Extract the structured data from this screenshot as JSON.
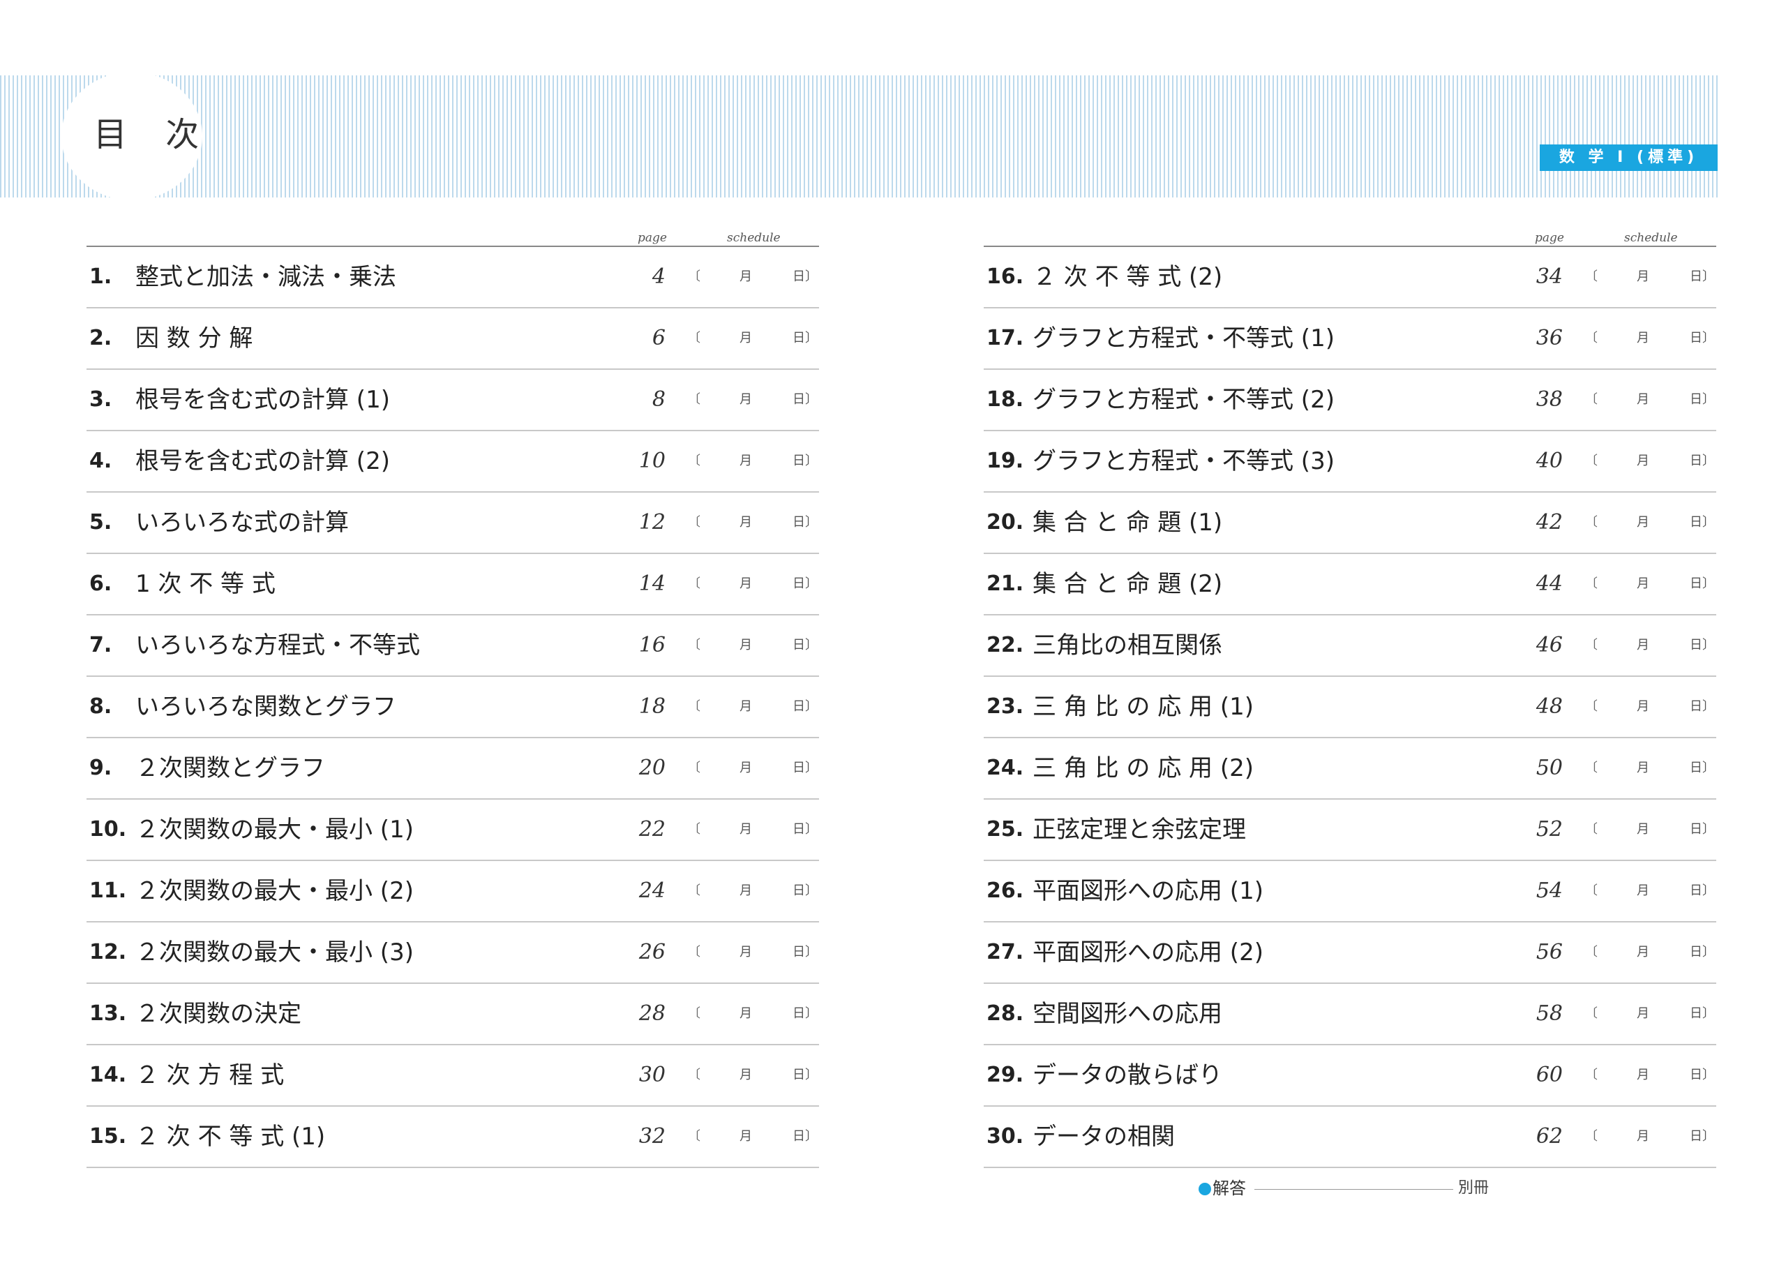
{
  "header": {
    "title": "目 次",
    "subject": "数 学 Ⅰ (標準)"
  },
  "columns_header": {
    "page": "page",
    "schedule": "schedule"
  },
  "schedule_marks": {
    "open": "〔",
    "month": "月",
    "close": "日〕"
  },
  "toc_left": [
    {
      "num": "1.",
      "title": "整式と加法・減法・乗法",
      "page": "4"
    },
    {
      "num": "2.",
      "title": "因 数 分 解",
      "page": "6"
    },
    {
      "num": "3.",
      "title": "根号を含む式の計算 (1)",
      "page": "8"
    },
    {
      "num": "4.",
      "title": "根号を含む式の計算 (2)",
      "page": "10"
    },
    {
      "num": "5.",
      "title": "いろいろな式の計算",
      "page": "12"
    },
    {
      "num": "6.",
      "title": "1 次 不 等 式",
      "page": "14"
    },
    {
      "num": "7.",
      "title": "いろいろな方程式・不等式",
      "page": "16"
    },
    {
      "num": "8.",
      "title": "いろいろな関数とグラフ",
      "page": "18"
    },
    {
      "num": "9.",
      "title": "２次関数とグラフ",
      "page": "20"
    },
    {
      "num": "10.",
      "title": "２次関数の最大・最小 (1)",
      "page": "22"
    },
    {
      "num": "11.",
      "title": "２次関数の最大・最小 (2)",
      "page": "24"
    },
    {
      "num": "12.",
      "title": "２次関数の最大・最小 (3)",
      "page": "26"
    },
    {
      "num": "13.",
      "title": "２次関数の決定",
      "page": "28"
    },
    {
      "num": "14.",
      "title": "２ 次 方 程 式",
      "page": "30"
    },
    {
      "num": "15.",
      "title": "２ 次 不 等 式 (1)",
      "page": "32"
    }
  ],
  "toc_right": [
    {
      "num": "16.",
      "title": "２ 次 不 等 式 (2)",
      "page": "34"
    },
    {
      "num": "17.",
      "title": "グラフと方程式・不等式 (1)",
      "page": "36"
    },
    {
      "num": "18.",
      "title": "グラフと方程式・不等式 (2)",
      "page": "38"
    },
    {
      "num": "19.",
      "title": "グラフと方程式・不等式 (3)",
      "page": "40"
    },
    {
      "num": "20.",
      "title": "集 合 と 命 題 (1)",
      "page": "42"
    },
    {
      "num": "21.",
      "title": "集 合 と 命 題 (2)",
      "page": "44"
    },
    {
      "num": "22.",
      "title": "三角比の相互関係",
      "page": "46"
    },
    {
      "num": "23.",
      "title": "三 角 比 の 応 用 (1)",
      "page": "48"
    },
    {
      "num": "24.",
      "title": "三 角 比 の 応 用 (2)",
      "page": "50"
    },
    {
      "num": "25.",
      "title": "正弦定理と余弦定理",
      "page": "52"
    },
    {
      "num": "26.",
      "title": "平面図形への応用 (1)",
      "page": "54"
    },
    {
      "num": "27.",
      "title": "平面図形への応用 (2)",
      "page": "56"
    },
    {
      "num": "28.",
      "title": "空間図形への応用",
      "page": "58"
    },
    {
      "num": "29.",
      "title": "データの散らばり",
      "page": "60"
    },
    {
      "num": "30.",
      "title": "データの相関",
      "page": "62"
    }
  ],
  "footer": {
    "answer_label": "解答",
    "answer_value": "別冊"
  },
  "colors": {
    "accent": "#1aa6e0",
    "stripe": "#bcd9ec"
  }
}
